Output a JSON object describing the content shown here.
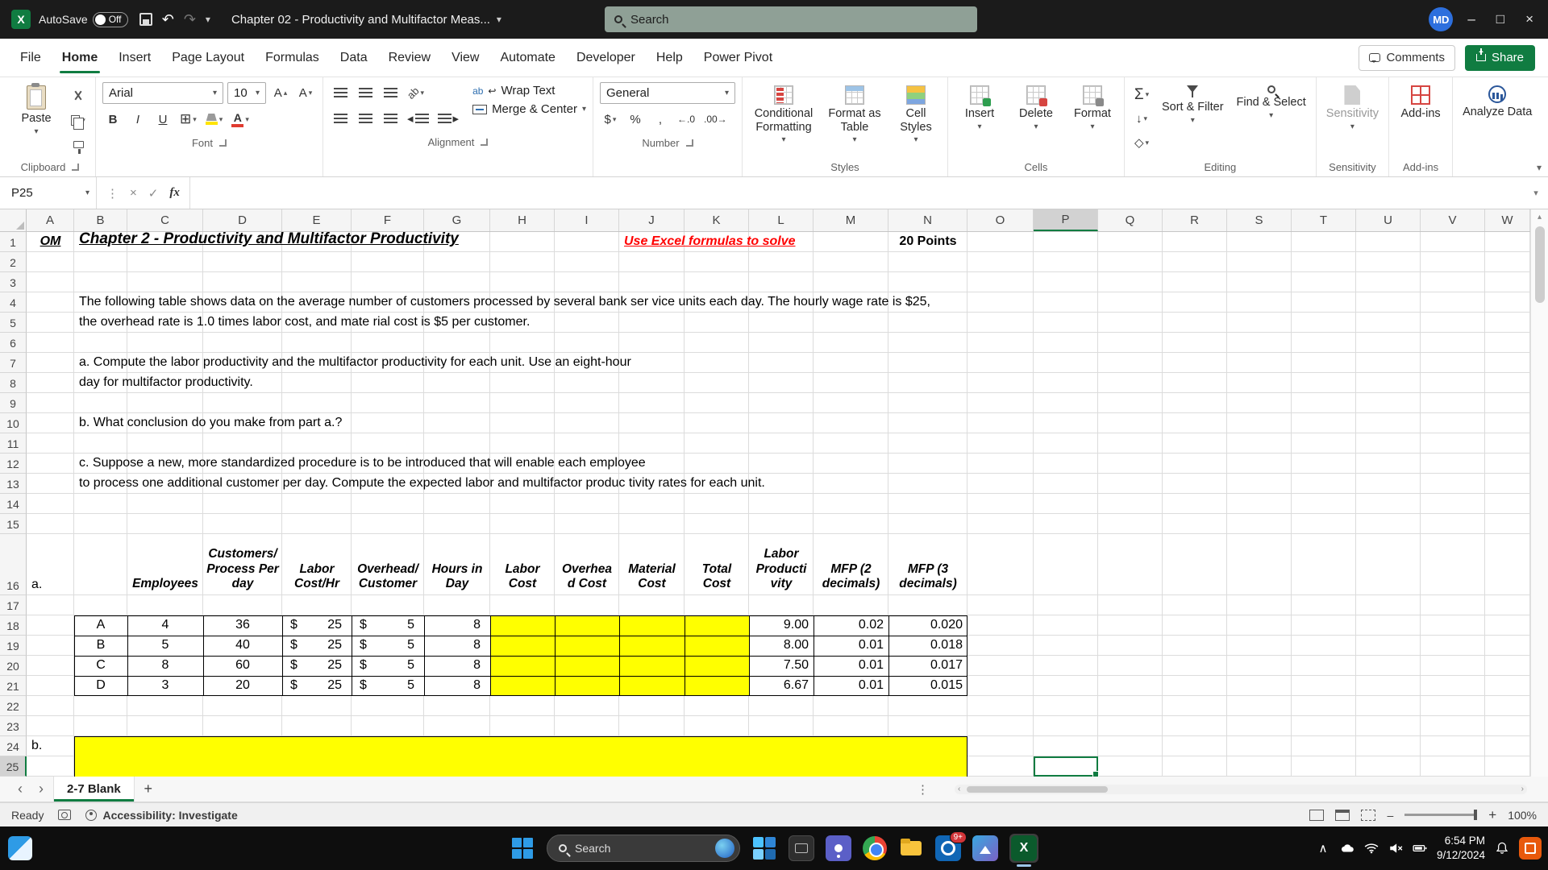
{
  "titlebar": {
    "autosave": "AutoSave",
    "autosave_state": "Off",
    "doc_title": "Chapter 02 - Productivity and Multifactor Meas...",
    "search": "Search",
    "avatar": "MD"
  },
  "menu": {
    "tabs": [
      "File",
      "Home",
      "Insert",
      "Page Layout",
      "Formulas",
      "Data",
      "Review",
      "View",
      "Automate",
      "Developer",
      "Help",
      "Power Pivot"
    ],
    "comments": "Comments",
    "share": "Share"
  },
  "ribbon": {
    "paste": "Paste",
    "clipboard": "Clipboard",
    "font_name": "Arial",
    "font_size": "10",
    "font": "Font",
    "wrap_text": "Wrap Text",
    "merge_center": "Merge & Center",
    "alignment": "Alignment",
    "number_format": "General",
    "number": "Number",
    "cond_fmt": "Conditional Formatting",
    "fmt_table": "Format as Table",
    "cell_styles": "Cell Styles",
    "styles": "Styles",
    "insert": "Insert",
    "del": "Delete",
    "format": "Format",
    "cells": "Cells",
    "sort_filter": "Sort & Filter",
    "find_select": "Find & Select",
    "editing": "Editing",
    "sensitivity": "Sensitivity",
    "sensitivity_group": "Sensitivity",
    "addins": "Add-ins",
    "addins_group": "Add-ins",
    "analyze": "Analyze Data"
  },
  "formula_bar": {
    "name_box": "P25"
  },
  "sheet": {
    "columns": [
      "A",
      "B",
      "C",
      "D",
      "E",
      "F",
      "G",
      "H",
      "I",
      "J",
      "K",
      "L",
      "M",
      "N",
      "O",
      "P",
      "Q",
      "R",
      "S",
      "T",
      "U",
      "V",
      "W"
    ],
    "rows": [
      "1",
      "2",
      "3",
      "4",
      "5",
      "6",
      "7",
      "8",
      "9",
      "10",
      "11",
      "12",
      "13",
      "14",
      "15",
      "16",
      "17",
      "18",
      "19",
      "20",
      "21",
      "22",
      "23",
      "24",
      "25"
    ],
    "cells": {
      "a1": "OM",
      "title": "Chapter 2 - Productivity and Multifactor Productivity ",
      "note": "Use Excel formulas to solve",
      "points": "20 Points",
      "p1a": "The following table shows data on the average number of customers processed by several bank ser vice units each day. The hourly wage rate is $25,",
      "p1b": "the overhead rate is 1.0 times labor cost, and mate rial cost is $5 per customer.",
      "p2a": "a. Compute the labor productivity and the multifactor productivity for each unit. Use an eight-hour",
      "p2b": "day for multifactor productivity.",
      "p3": "b. What conclusion do you make from part a.?",
      "p4a": "c. Suppose a new, more standardized procedure is to be introduced that will enable each employee",
      "p4b": "to process one additional customer per day. Compute the expected labor and multifactor produc tivity rates for each unit.",
      "label_a": "a.",
      "label_b": "b."
    },
    "table": {
      "currency": "$",
      "headers": [
        "Employees",
        "Customers/\nProcess Per\nday",
        "Labor\nCost/Hr",
        "Overhead/\nCustomer",
        "Hours in\nDay",
        "Labor\nCost",
        "Overhea\nd Cost",
        "Material\nCost",
        "Total\nCost",
        "Labor\nProducti\nvity",
        "MFP (2\ndecimals)",
        "MFP (3\ndecimals)"
      ],
      "rows": [
        {
          "unit": "A",
          "employees": "4",
          "customers": "36",
          "labor_rate": "25",
          "overhead_rate": "5",
          "hours": "8",
          "labor_productivity": "9.00",
          "mfp2": "0.02",
          "mfp3": "0.020"
        },
        {
          "unit": "B",
          "employees": "5",
          "customers": "40",
          "labor_rate": "25",
          "overhead_rate": "5",
          "hours": "8",
          "labor_productivity": "8.00",
          "mfp2": "0.01",
          "mfp3": "0.018"
        },
        {
          "unit": "C",
          "employees": "8",
          "customers": "60",
          "labor_rate": "25",
          "overhead_rate": "5",
          "hours": "8",
          "labor_productivity": "7.50",
          "mfp2": "0.01",
          "mfp3": "0.017"
        },
        {
          "unit": "D",
          "employees": "3",
          "customers": "20",
          "labor_rate": "25",
          "overhead_rate": "5",
          "hours": "8",
          "labor_productivity": "6.67",
          "mfp2": "0.01",
          "mfp3": "0.015"
        }
      ]
    }
  },
  "tabs_bar": {
    "sheet_name": "2-7 Blank",
    "add_sheet": "+"
  },
  "status_bar": {
    "ready": "Ready",
    "accessibility": "Accessibility: Investigate",
    "zoom": "100%"
  },
  "taskbar": {
    "search": "Search",
    "badge": "9+",
    "time": "6:54 PM",
    "date": "9/12/2024"
  },
  "icons": {
    "dropdown": "▾",
    "chev_left": "‹",
    "chev_right": "›",
    "chev_up": "∧",
    "dots_v": "⋮",
    "undo": "↶",
    "redo": "↷",
    "cancel": "×",
    "check": "✓",
    "fx": "fx",
    "sigma": "Σ",
    "dollar": "$",
    "percent": "%",
    "comma": ",",
    "inc_decimal": "←.0",
    "dec_decimal": ".00→",
    "bold": "B",
    "italic": "I",
    "underline": "U",
    "letter_a": "A",
    "up_small": "▴",
    "down_small": "▾",
    "borders": "⊞",
    "ab": "ab",
    "return": "↩",
    "minimize": "–",
    "maximize": "□",
    "close": "×",
    "excel_x": "X",
    "down_arrow": "↓",
    "eraser": "◇",
    "left_tri": "◂",
    "right_tri": "▸"
  }
}
